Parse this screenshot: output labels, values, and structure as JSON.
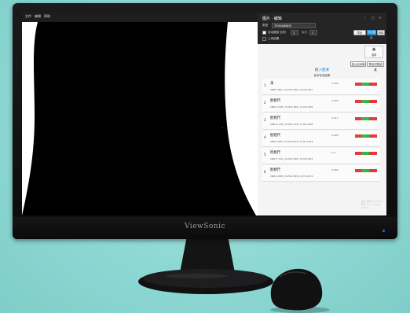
{
  "monitor": {
    "brand": "ViewSonic"
  },
  "screen": {
    "menubar": [
      "文件",
      "编辑",
      "帮助"
    ],
    "panel": {
      "title": "图片 · 编辑",
      "window_controls": [
        "–",
        "□",
        "✕"
      ],
      "row1": {
        "label": "类型",
        "value": "TEXDABBDE",
        "buttons": [
          "导出JSON",
          "导出图片",
          "清除"
        ]
      },
      "row2": {
        "label": "自动缩放·比例",
        "fields": [
          "1",
          "1"
        ],
        "label2": "大小"
      },
      "row3": {
        "checkbox_label": "上传结果",
        "buttons": [
          "加入比对库",
          "导出识别结果"
        ]
      },
      "tool": {
        "glyph": "✥",
        "label": "选择"
      },
      "section_title": "输入脸本",
      "section_subtitle": "脸本检测结果",
      "items": [
        {
          "num": "1",
          "name": "未",
          "sub": "CNR 0.987 | 0.23,0.598 | 0.23,0.497",
          "value": "0.935"
        },
        {
          "num": "2",
          "name": "脸相尺",
          "sub": "CNR 0.238 | 0.18,0.398 | 0.23,0.395",
          "value": "0.920"
        },
        {
          "num": "3",
          "name": "脸相尺",
          "sub": "CNR 0.178 | 0.29,0.479 | 0.32,0.499",
          "value": "0.911"
        },
        {
          "num": "4",
          "name": "脸相尺",
          "sub": "CNR 0.965 | 0.29,0.512 | 0.31,0.523",
          "value": "0.908"
        },
        {
          "num": "5",
          "name": "检相尺",
          "sub": "CNR 0.712 | 0.29,0.598 | 0.23,0.641",
          "value": "0.9"
        },
        {
          "num": "6",
          "name": "脸相尺",
          "sub": "CNR 0.698 | 0.25,0.599 | 0.27,0.674",
          "value": "0.894"
        }
      ],
      "watermark": [
        "图片·编辑 Machine",
        "软件 v2.3 · 2020 Edition"
      ]
    }
  }
}
